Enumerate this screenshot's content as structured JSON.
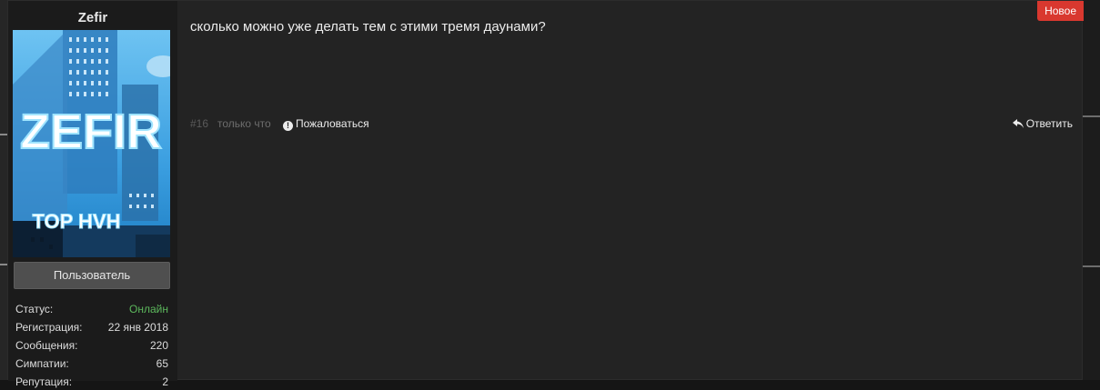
{
  "author": {
    "name": "Zefir",
    "avatar_text": "ZEFIR",
    "avatar_subtext": "TOP HVH",
    "role": "Пользователь",
    "stats": [
      {
        "label": "Статус:",
        "value": "Онлайн"
      },
      {
        "label": "Регистрация:",
        "value": "22 янв 2018"
      },
      {
        "label": "Сообщения:",
        "value": "220"
      },
      {
        "label": "Симпатии:",
        "value": "65"
      },
      {
        "label": "Репутация:",
        "value": "2"
      }
    ]
  },
  "post": {
    "message": "сколько можно уже делать тем с этими тремя даунами?",
    "badge": "Новое",
    "number": "#16",
    "time": "только что",
    "report_label": "Пожаловаться",
    "reply_label": "Ответить"
  },
  "colors": {
    "online": "#5cb85c",
    "badge": "#d9382f",
    "avatar_sky": "#4aa8e6"
  },
  "icons": {
    "report": "exclamation-circle-icon",
    "reply": "reply-arrow-icon"
  }
}
